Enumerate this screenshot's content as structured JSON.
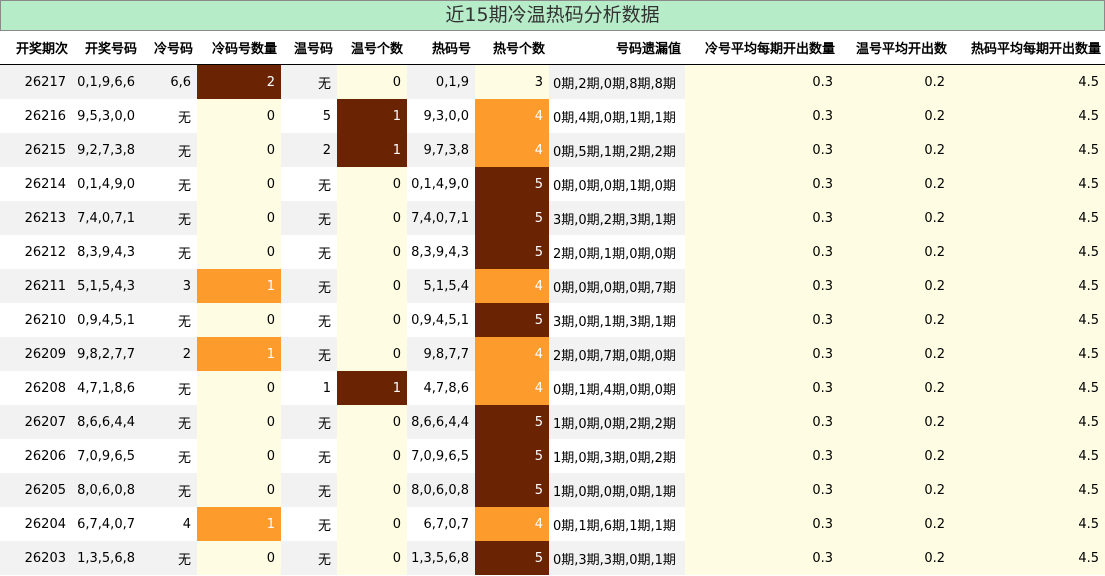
{
  "title": "近15期冷温热码分析数据",
  "headers": [
    "开奖期次",
    "开奖号码",
    "冷号码",
    "冷码号数量",
    "温号码",
    "温号个数",
    "热码号",
    "热号个数",
    "号码遗漏值",
    "冷号平均每期开出数量",
    "温号平均开出数",
    "热码平均每期开出数量"
  ],
  "colors": {
    "title_bg": "#b7ecc9",
    "cream": "#fefde4",
    "orange": "#fd9b2d",
    "brown": "#6a2404"
  },
  "rows": [
    {
      "period": "26217",
      "nums": "0,1,9,6,6",
      "cold": "6,6",
      "cold_n": "2",
      "warm": "无",
      "warm_n": "0",
      "hot": "0,1,9",
      "hot_n": "3",
      "misses": "0期,2期,0期,8期,8期",
      "avg_cold": "0.3",
      "avg_warm": "0.2",
      "avg_hot": "4.5"
    },
    {
      "period": "26216",
      "nums": "9,5,3,0,0",
      "cold": "无",
      "cold_n": "0",
      "warm": "5",
      "warm_n": "1",
      "hot": "9,3,0,0",
      "hot_n": "4",
      "misses": "0期,4期,0期,1期,1期",
      "avg_cold": "0.3",
      "avg_warm": "0.2",
      "avg_hot": "4.5"
    },
    {
      "period": "26215",
      "nums": "9,2,7,3,8",
      "cold": "无",
      "cold_n": "0",
      "warm": "2",
      "warm_n": "1",
      "hot": "9,7,3,8",
      "hot_n": "4",
      "misses": "0期,5期,1期,2期,2期",
      "avg_cold": "0.3",
      "avg_warm": "0.2",
      "avg_hot": "4.5"
    },
    {
      "period": "26214",
      "nums": "0,1,4,9,0",
      "cold": "无",
      "cold_n": "0",
      "warm": "无",
      "warm_n": "0",
      "hot": "0,1,4,9,0",
      "hot_n": "5",
      "misses": "0期,0期,0期,1期,0期",
      "avg_cold": "0.3",
      "avg_warm": "0.2",
      "avg_hot": "4.5"
    },
    {
      "period": "26213",
      "nums": "7,4,0,7,1",
      "cold": "无",
      "cold_n": "0",
      "warm": "无",
      "warm_n": "0",
      "hot": "7,4,0,7,1",
      "hot_n": "5",
      "misses": "3期,0期,2期,3期,1期",
      "avg_cold": "0.3",
      "avg_warm": "0.2",
      "avg_hot": "4.5"
    },
    {
      "period": "26212",
      "nums": "8,3,9,4,3",
      "cold": "无",
      "cold_n": "0",
      "warm": "无",
      "warm_n": "0",
      "hot": "8,3,9,4,3",
      "hot_n": "5",
      "misses": "2期,0期,1期,0期,0期",
      "avg_cold": "0.3",
      "avg_warm": "0.2",
      "avg_hot": "4.5"
    },
    {
      "period": "26211",
      "nums": "5,1,5,4,3",
      "cold": "3",
      "cold_n": "1",
      "warm": "无",
      "warm_n": "0",
      "hot": "5,1,5,4",
      "hot_n": "4",
      "misses": "0期,0期,0期,0期,7期",
      "avg_cold": "0.3",
      "avg_warm": "0.2",
      "avg_hot": "4.5"
    },
    {
      "period": "26210",
      "nums": "0,9,4,5,1",
      "cold": "无",
      "cold_n": "0",
      "warm": "无",
      "warm_n": "0",
      "hot": "0,9,4,5,1",
      "hot_n": "5",
      "misses": "3期,0期,1期,3期,1期",
      "avg_cold": "0.3",
      "avg_warm": "0.2",
      "avg_hot": "4.5"
    },
    {
      "period": "26209",
      "nums": "9,8,2,7,7",
      "cold": "2",
      "cold_n": "1",
      "warm": "无",
      "warm_n": "0",
      "hot": "9,8,7,7",
      "hot_n": "4",
      "misses": "2期,0期,7期,0期,0期",
      "avg_cold": "0.3",
      "avg_warm": "0.2",
      "avg_hot": "4.5"
    },
    {
      "period": "26208",
      "nums": "4,7,1,8,6",
      "cold": "无",
      "cold_n": "0",
      "warm": "1",
      "warm_n": "1",
      "hot": "4,7,8,6",
      "hot_n": "4",
      "misses": "0期,1期,4期,0期,0期",
      "avg_cold": "0.3",
      "avg_warm": "0.2",
      "avg_hot": "4.5"
    },
    {
      "period": "26207",
      "nums": "8,6,6,4,4",
      "cold": "无",
      "cold_n": "0",
      "warm": "无",
      "warm_n": "0",
      "hot": "8,6,6,4,4",
      "hot_n": "5",
      "misses": "1期,0期,0期,2期,2期",
      "avg_cold": "0.3",
      "avg_warm": "0.2",
      "avg_hot": "4.5"
    },
    {
      "period": "26206",
      "nums": "7,0,9,6,5",
      "cold": "无",
      "cold_n": "0",
      "warm": "无",
      "warm_n": "0",
      "hot": "7,0,9,6,5",
      "hot_n": "5",
      "misses": "1期,0期,3期,0期,2期",
      "avg_cold": "0.3",
      "avg_warm": "0.2",
      "avg_hot": "4.5"
    },
    {
      "period": "26205",
      "nums": "8,0,6,0,8",
      "cold": "无",
      "cold_n": "0",
      "warm": "无",
      "warm_n": "0",
      "hot": "8,0,6,0,8",
      "hot_n": "5",
      "misses": "1期,0期,0期,0期,1期",
      "avg_cold": "0.3",
      "avg_warm": "0.2",
      "avg_hot": "4.5"
    },
    {
      "period": "26204",
      "nums": "6,7,4,0,7",
      "cold": "4",
      "cold_n": "1",
      "warm": "无",
      "warm_n": "0",
      "hot": "6,7,0,7",
      "hot_n": "4",
      "misses": "0期,1期,6期,1期,1期",
      "avg_cold": "0.3",
      "avg_warm": "0.2",
      "avg_hot": "4.5"
    },
    {
      "period": "26203",
      "nums": "1,3,5,6,8",
      "cold": "无",
      "cold_n": "0",
      "warm": "无",
      "warm_n": "0",
      "hot": "1,3,5,6,8",
      "hot_n": "5",
      "misses": "0期,3期,3期,0期,1期",
      "avg_cold": "0.3",
      "avg_warm": "0.2",
      "avg_hot": "4.5"
    }
  ]
}
